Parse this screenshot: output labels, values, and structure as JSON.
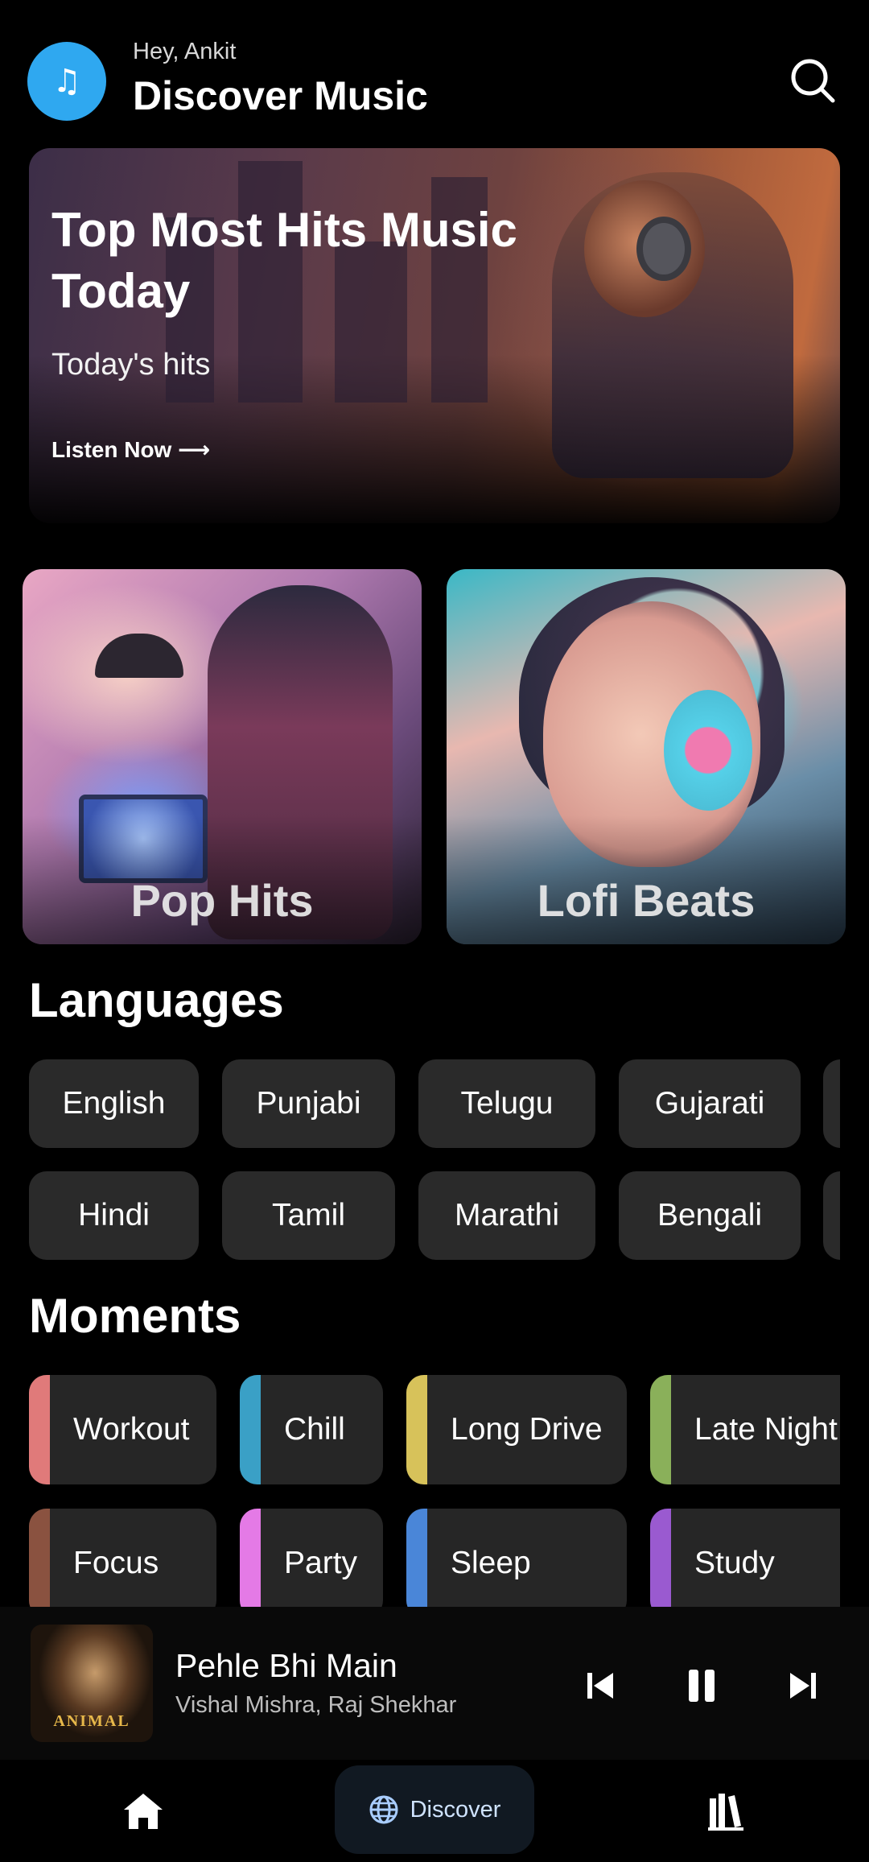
{
  "header": {
    "greeting": "Hey, Ankit",
    "title": "Discover Music",
    "logo_icon": "♫"
  },
  "hero": {
    "title": "Top Most Hits Music Today",
    "subtitle": "Today's hits",
    "cta": "Listen Now ⟶"
  },
  "categories": [
    {
      "label": "Pop Hits"
    },
    {
      "label": "Lofi Beats"
    }
  ],
  "languages": {
    "title": "Languages",
    "row1": [
      "English",
      "Punjabi",
      "Telugu",
      "Gujarati"
    ],
    "row2": [
      "Hindi",
      "Tamil",
      "Marathi",
      "Bengali"
    ]
  },
  "moments": {
    "title": "Moments",
    "row1": [
      {
        "label": "Workout",
        "color": "#e07a7a"
      },
      {
        "label": "Chill",
        "color": "#3aa0c6"
      },
      {
        "label": "Long Drive",
        "color": "#d7c25a"
      },
      {
        "label": "Late Night",
        "color": "#8ab05a"
      }
    ],
    "row2": [
      {
        "label": "Focus",
        "color": "#8a5240"
      },
      {
        "label": "Party",
        "color": "#e47ae6"
      },
      {
        "label": "Sleep",
        "color": "#4a86d8"
      },
      {
        "label": "Study",
        "color": "#9a5ad0"
      }
    ]
  },
  "player": {
    "song": "Pehle Bhi Main",
    "artist": "Vishal Mishra, Raj Shekhar",
    "album_text": "ANIMAL"
  },
  "nav": {
    "discover_label": "Discover"
  },
  "colors": {
    "accent": "#2fa8f0",
    "chip_bg": "#2a2a2a"
  }
}
